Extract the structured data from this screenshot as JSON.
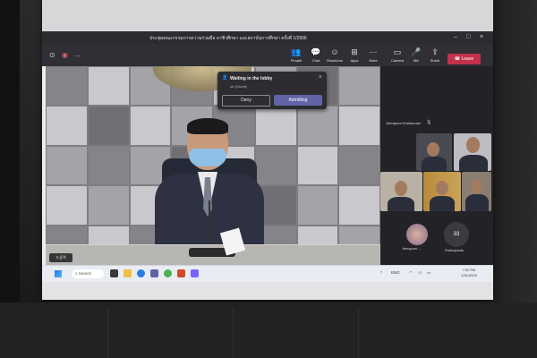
{
  "window": {
    "title": "ประชุมคณะกรรมการความร่วมมือ อาชีวศึกษา และสถาบันการศึกษา ครั้งที่ 1/2566"
  },
  "toolbar": {
    "timer": "--:-",
    "buttons": [
      {
        "label": "People",
        "icon": "people-icon"
      },
      {
        "label": "Chat",
        "icon": "chat-icon"
      },
      {
        "label": "Reactions",
        "icon": "reactions-icon"
      },
      {
        "label": "Apps",
        "icon": "apps-icon"
      },
      {
        "label": "More",
        "icon": "more-icon"
      },
      {
        "label": "Camera",
        "icon": "camera-icon"
      },
      {
        "label": "Mic",
        "icon": "mic-icon"
      },
      {
        "label": "Share",
        "icon": "share-icon"
      }
    ],
    "leave_label": "Leave"
  },
  "lobby": {
    "title": "Waiting in the lobby",
    "guest": "srt (Guest)",
    "deny_label": "Deny",
    "admit_label": "Admitting"
  },
  "stage": {
    "badge": "ผู้ใช้"
  },
  "sidebar": {
    "pinned_name": "Jeerapom Khotsuman",
    "small_name": "Jeerapom ...",
    "participant_count": "33",
    "participants_label": "Participants"
  },
  "taskbar": {
    "search_label": "Search",
    "lang": "ENG",
    "time": "7:02 PM",
    "date": "1/31/2023"
  }
}
